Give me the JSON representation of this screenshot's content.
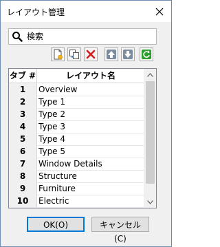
{
  "window": {
    "title": "レイアウト管理",
    "close_icon": "close-icon"
  },
  "search": {
    "icon": "magnifier-icon",
    "placeholder": "検索",
    "value": ""
  },
  "toolbar": {
    "buttons": [
      {
        "name": "new-layout-button",
        "icon": "new-document-icon"
      },
      {
        "name": "copy-layout-button",
        "icon": "copy-icon"
      },
      {
        "name": "delete-layout-button",
        "icon": "delete-red-x-icon"
      },
      {
        "name": "move-up-button",
        "icon": "arrow-up-icon"
      },
      {
        "name": "move-down-button",
        "icon": "arrow-down-icon"
      },
      {
        "name": "refresh-button",
        "icon": "refresh-green-icon"
      }
    ]
  },
  "table": {
    "columns": [
      "タブ #",
      "レイアウト名"
    ],
    "rows": [
      {
        "num": "1",
        "name": "Overview"
      },
      {
        "num": "2",
        "name": "Type 1"
      },
      {
        "num": "3",
        "name": "Type 2"
      },
      {
        "num": "4",
        "name": "Type 3"
      },
      {
        "num": "5",
        "name": "Type 4"
      },
      {
        "num": "6",
        "name": "Type 5"
      },
      {
        "num": "7",
        "name": "Window Details"
      },
      {
        "num": "8",
        "name": "Structure"
      },
      {
        "num": "9",
        "name": "Furniture"
      },
      {
        "num": "10",
        "name": "Electric"
      }
    ]
  },
  "buttons": {
    "ok_label": "OK(O)",
    "cancel_label": "キャンセル(C)"
  },
  "colors": {
    "accent": "#0078d7",
    "delete_red": "#d32020",
    "refresh_green": "#2ca02c"
  }
}
